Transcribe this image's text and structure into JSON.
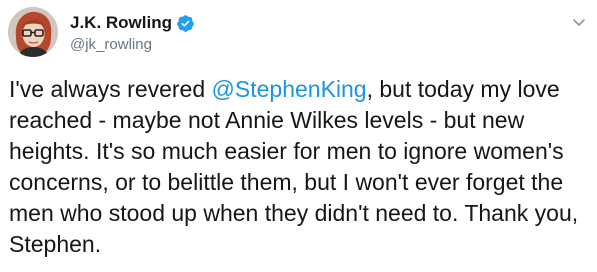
{
  "author": {
    "display_name": "J.K. Rowling",
    "handle": "@jk_rowling",
    "verified_icon": "verified-badge-icon",
    "avatar_icon": "avatar"
  },
  "menu": {
    "icon": "chevron-down-icon"
  },
  "tweet": {
    "line1_before": "I've always revered ",
    "mention": "@StephenKing",
    "line1_after": ", but today my love",
    "line2": "reached - maybe not Annie Wilkes levels - but new",
    "line3": "heights. It's so much easier for men to ignore women's",
    "line4": "concerns, or to belittle them, but I won't ever forget the",
    "line5": "men who stood up when they didn't need to. Thank you,",
    "line6": "Stephen."
  },
  "colors": {
    "text": "#14171a",
    "handle": "#657786",
    "mention": "#1b95e0",
    "verified": "#1da1f2"
  }
}
